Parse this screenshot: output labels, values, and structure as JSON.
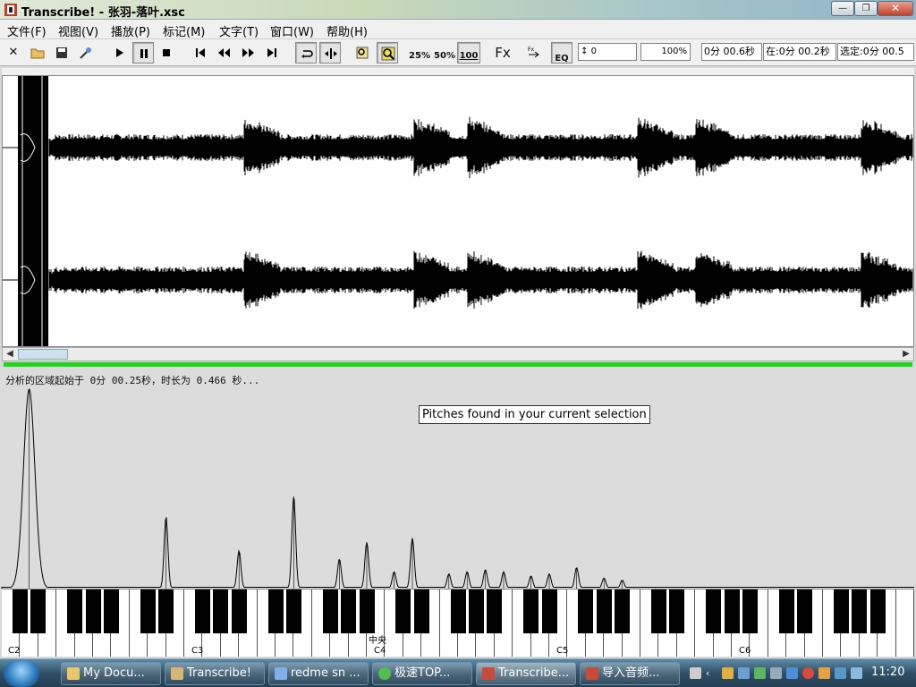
{
  "window": {
    "title": "Transcribe! - 张羽-落叶.xsc",
    "min_label": "—",
    "max_label": "❐",
    "close_label": "✕"
  },
  "menu": [
    {
      "label": "文件(F)"
    },
    {
      "label": "视图(V)"
    },
    {
      "label": "播放(P)"
    },
    {
      "label": "标记(M)"
    },
    {
      "label": "文字(T)"
    },
    {
      "label": "窗口(W)"
    },
    {
      "label": "帮助(H)"
    }
  ],
  "toolbar": {
    "speed_25": "25%",
    "speed_50": "50%",
    "speed_100": "100",
    "fx": "Fx",
    "fx_eq": "EQ",
    "pitch_value": "0",
    "tempo_value": "100%",
    "readout_position": "0分 00.6秒",
    "readout_at": "在:0分 00.2秒",
    "readout_selection": "选定:0分 00.5"
  },
  "analysis": {
    "status_text": "分析的区域起始于 0分 00.25秒，时长为 0.466 秒...",
    "tooltip": "Pitches found in your current selection"
  },
  "piano": {
    "labels": {
      "c2": "C2",
      "c3": "C3",
      "c4": "C4",
      "c4_middle": "中央",
      "c5": "C5",
      "c6": "C6"
    }
  },
  "spectrum_peaks": [
    {
      "note_index": 2,
      "level": 0.95
    },
    {
      "note_index": 15,
      "level": 0.34
    },
    {
      "note_index": 22,
      "level": 0.18
    },
    {
      "note_index": 27,
      "level": 0.44
    },
    {
      "note_index": 31,
      "level": 0.14
    },
    {
      "note_index": 34,
      "level": 0.22
    },
    {
      "note_index": 36,
      "level": 0.08
    },
    {
      "note_index": 38,
      "level": 0.24
    },
    {
      "note_index": 41,
      "level": 0.07
    },
    {
      "note_index": 43,
      "level": 0.08
    },
    {
      "note_index": 45,
      "level": 0.09
    },
    {
      "note_index": 47,
      "level": 0.08
    },
    {
      "note_index": 49,
      "level": 0.06
    },
    {
      "note_index": 51,
      "level": 0.07
    },
    {
      "note_index": 53,
      "level": 0.1
    },
    {
      "note_index": 56,
      "level": 0.05
    },
    {
      "note_index": 58,
      "level": 0.04
    }
  ],
  "taskbar": {
    "items": [
      {
        "label": "My Docu...",
        "color": "#e8c66a"
      },
      {
        "label": "Transcribe!",
        "color": "#d6b778"
      },
      {
        "label": "redme sn ...",
        "color": "#7fb0e8"
      },
      {
        "label": "极速TOP...",
        "color": "#4fc04f"
      },
      {
        "label": "Transcribe...",
        "color": "#c84b3a"
      },
      {
        "label": "导入音频...",
        "color": "#c84b3a"
      }
    ],
    "clock": "11:20"
  }
}
